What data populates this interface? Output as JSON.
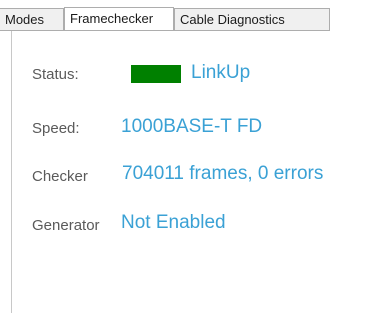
{
  "tabs": [
    {
      "label": "Modes"
    },
    {
      "label": "Framechecker"
    },
    {
      "label": "Cable Diagnostics"
    }
  ],
  "active_tab": "Framechecker",
  "status": {
    "label": "Status:",
    "value": "LinkUp",
    "indicator_color": "#008000"
  },
  "speed": {
    "label": "Speed:",
    "value": "1000BASE-T FD"
  },
  "checker": {
    "label": "Checker",
    "value": "704011 frames, 0 errors"
  },
  "generator": {
    "label": "Generator",
    "value": "Not Enabled"
  }
}
